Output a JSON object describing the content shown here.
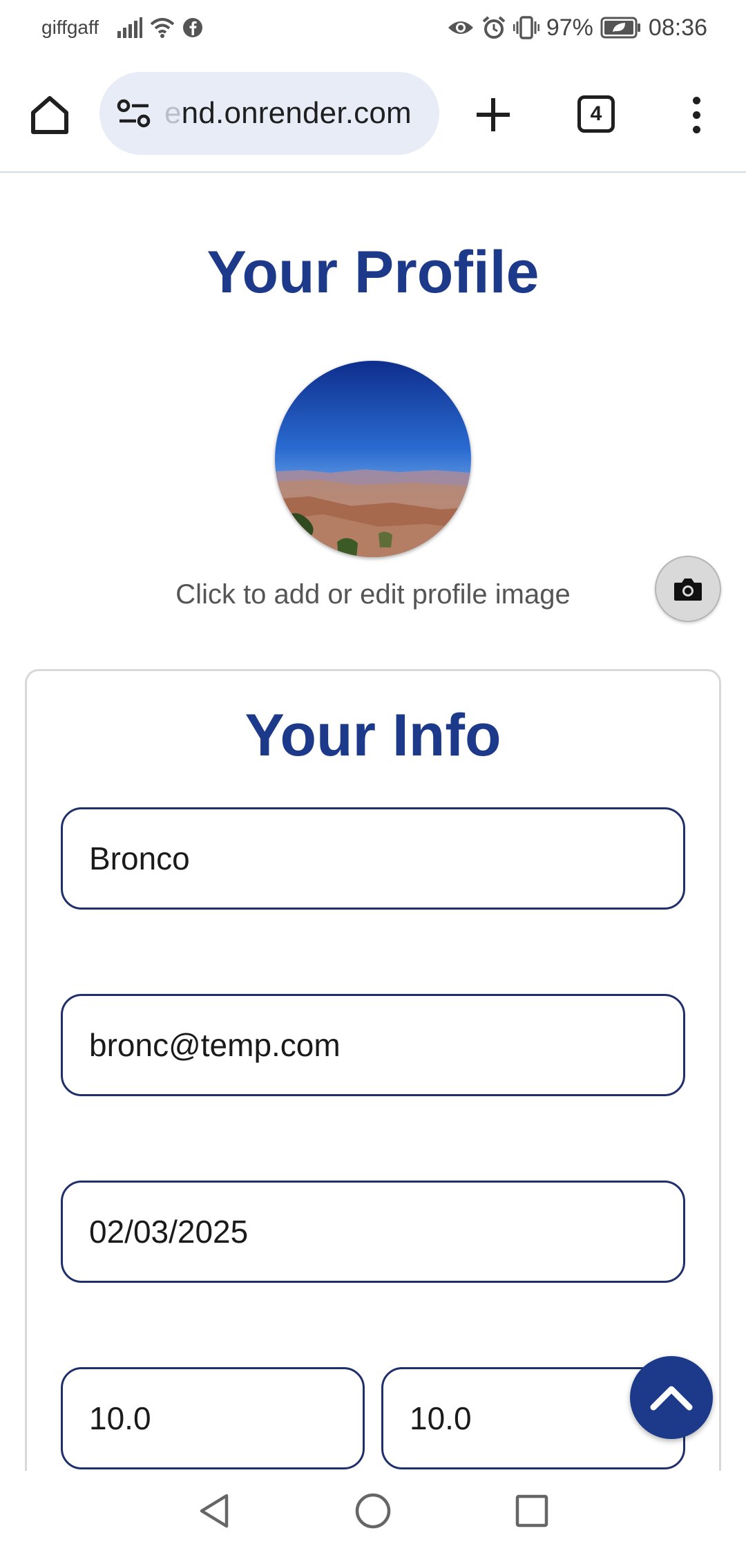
{
  "status_bar": {
    "carrier": "giffgaff",
    "battery": "97%",
    "time": "08:36",
    "icons": [
      "signal-icon",
      "wifi-icon",
      "facebook-icon",
      "eye-icon",
      "alarm-icon",
      "vibrate-icon",
      "battery-saver-icon"
    ]
  },
  "browser": {
    "url_faded_prefix": "e",
    "url": "nd.onrender.com",
    "tab_count": "4",
    "icons": [
      "home-icon",
      "site-settings-icon",
      "plus-icon",
      "tab-switcher-icon",
      "more-vert-icon"
    ]
  },
  "profile": {
    "title": "Your Profile",
    "image_hint": "Click to add or edit profile image",
    "camera_icon": "camera-icon"
  },
  "info": {
    "title": "Your Info",
    "name": "Bronco",
    "email": "bronc@temp.com",
    "date": "02/03/2025",
    "value_a": "10.0",
    "value_b": "10.0"
  },
  "colors": {
    "accent": "#1d3a8a",
    "field_border": "#1f2f6b",
    "url_bar_bg": "#e8ecf6"
  },
  "system_nav": {
    "icons": [
      "back-icon",
      "home-circle-icon",
      "recents-icon"
    ]
  }
}
